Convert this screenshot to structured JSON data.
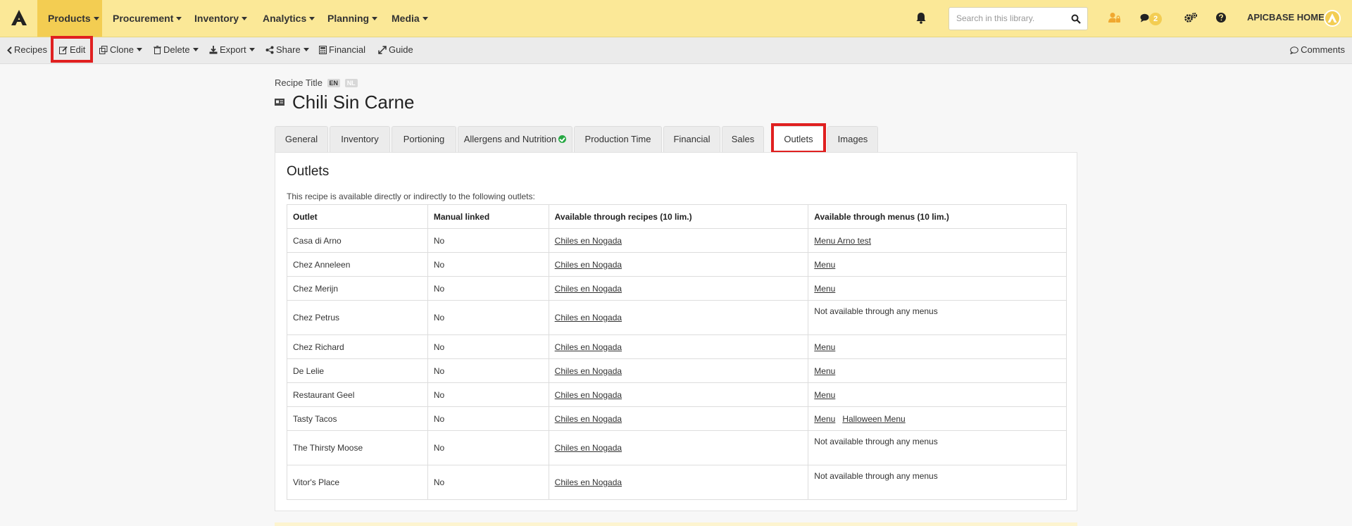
{
  "nav": {
    "items": [
      "Products",
      "Procurement",
      "Inventory",
      "Analytics",
      "Planning",
      "Media"
    ],
    "search_placeholder": "Search in this library.",
    "chat_count": "2",
    "home_label": "APICBASE HOME"
  },
  "toolbar": {
    "back": "Recipes",
    "edit": "Edit",
    "clone": "Clone",
    "delete": "Delete",
    "export": "Export",
    "share": "Share",
    "financial": "Financial",
    "guide": "Guide",
    "comments": "Comments"
  },
  "recipe": {
    "title_label": "Recipe Title",
    "lang_en": "EN",
    "lang_nl": "NL",
    "title": "Chili Sin Carne"
  },
  "tabs": [
    "General",
    "Inventory",
    "Portioning",
    "Allergens and Nutrition",
    "Production Time",
    "Financial",
    "Sales",
    "Outlets",
    "Images"
  ],
  "outlets": {
    "heading": "Outlets",
    "description": "This recipe is available directly or indirectly to the following outlets:",
    "columns": [
      "Outlet",
      "Manual linked",
      "Available through recipes (10 lim.)",
      "Available through menus (10 lim.)"
    ],
    "rows": [
      {
        "outlet": "Casa di Arno",
        "manual": "No",
        "recipe": "Chiles en Nogada",
        "menu1": "Menu Arno test",
        "menu2": "",
        "menu_text": ""
      },
      {
        "outlet": "Chez Anneleen",
        "manual": "No",
        "recipe": "Chiles en Nogada",
        "menu1": "Menu",
        "menu2": "",
        "menu_text": ""
      },
      {
        "outlet": "Chez Merijn",
        "manual": "No",
        "recipe": "Chiles en Nogada",
        "menu1": "Menu",
        "menu2": "",
        "menu_text": ""
      },
      {
        "outlet": "Chez Petrus",
        "manual": "No",
        "recipe": "Chiles en Nogada",
        "menu1": "",
        "menu2": "",
        "menu_text": "Not available through any menus"
      },
      {
        "outlet": "Chez Richard",
        "manual": "No",
        "recipe": "Chiles en Nogada",
        "menu1": "Menu",
        "menu2": "",
        "menu_text": ""
      },
      {
        "outlet": "De Lelie",
        "manual": "No",
        "recipe": "Chiles en Nogada",
        "menu1": "Menu",
        "menu2": "",
        "menu_text": ""
      },
      {
        "outlet": "Restaurant Geel",
        "manual": "No",
        "recipe": "Chiles en Nogada",
        "menu1": "Menu",
        "menu2": "",
        "menu_text": ""
      },
      {
        "outlet": "Tasty Tacos",
        "manual": "No",
        "recipe": "Chiles en Nogada",
        "menu1": "Menu",
        "menu2": "Halloween Menu",
        "menu_text": ""
      },
      {
        "outlet": "The Thirsty Moose",
        "manual": "No",
        "recipe": "Chiles en Nogada",
        "menu1": "",
        "menu2": "",
        "menu_text": "Not available through any menus"
      },
      {
        "outlet": "Vitor's Place",
        "manual": "No",
        "recipe": "Chiles en Nogada",
        "menu1": "",
        "menu2": "",
        "menu_text": "Not available through any menus"
      }
    ]
  },
  "colors": {
    "navbar": "#fbe897",
    "active_nav": "#f3cd52",
    "highlight": "#e02020",
    "check": "#27a844"
  }
}
